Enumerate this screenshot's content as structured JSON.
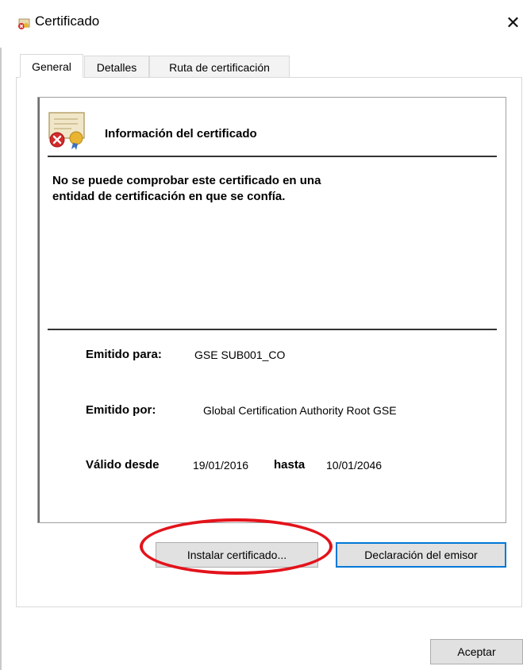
{
  "window": {
    "title": "Certificado",
    "close_symbol": "✕"
  },
  "tabs": [
    {
      "label": "General",
      "active": true
    },
    {
      "label": "Detalles",
      "active": false
    },
    {
      "label": "Ruta de certificación",
      "active": false
    }
  ],
  "info": {
    "heading": "Información del certificado",
    "warning_line1": "No se puede comprobar este certificado en una",
    "warning_line2": "entidad de certificación en que se confía.",
    "issued_to_label": "Emitido para:",
    "issued_to_value": "GSE SUB001_CO",
    "issued_by_label": "Emitido por:",
    "issued_by_value": "Global Certification Authority Root GSE",
    "valid_from_label": "Válido desde",
    "valid_from_value": "19/01/2016",
    "valid_to_label": "hasta",
    "valid_to_value": "10/01/2046"
  },
  "buttons": {
    "install": "Instalar certificado...",
    "issuer_statement": "Declaración del emisor",
    "accept": "Aceptar"
  },
  "icons": {
    "app": "certificate-error-icon",
    "info": "certificate-error-large-icon"
  },
  "colors": {
    "highlight_ring": "#e3131b",
    "focus_border": "#0078d7"
  }
}
